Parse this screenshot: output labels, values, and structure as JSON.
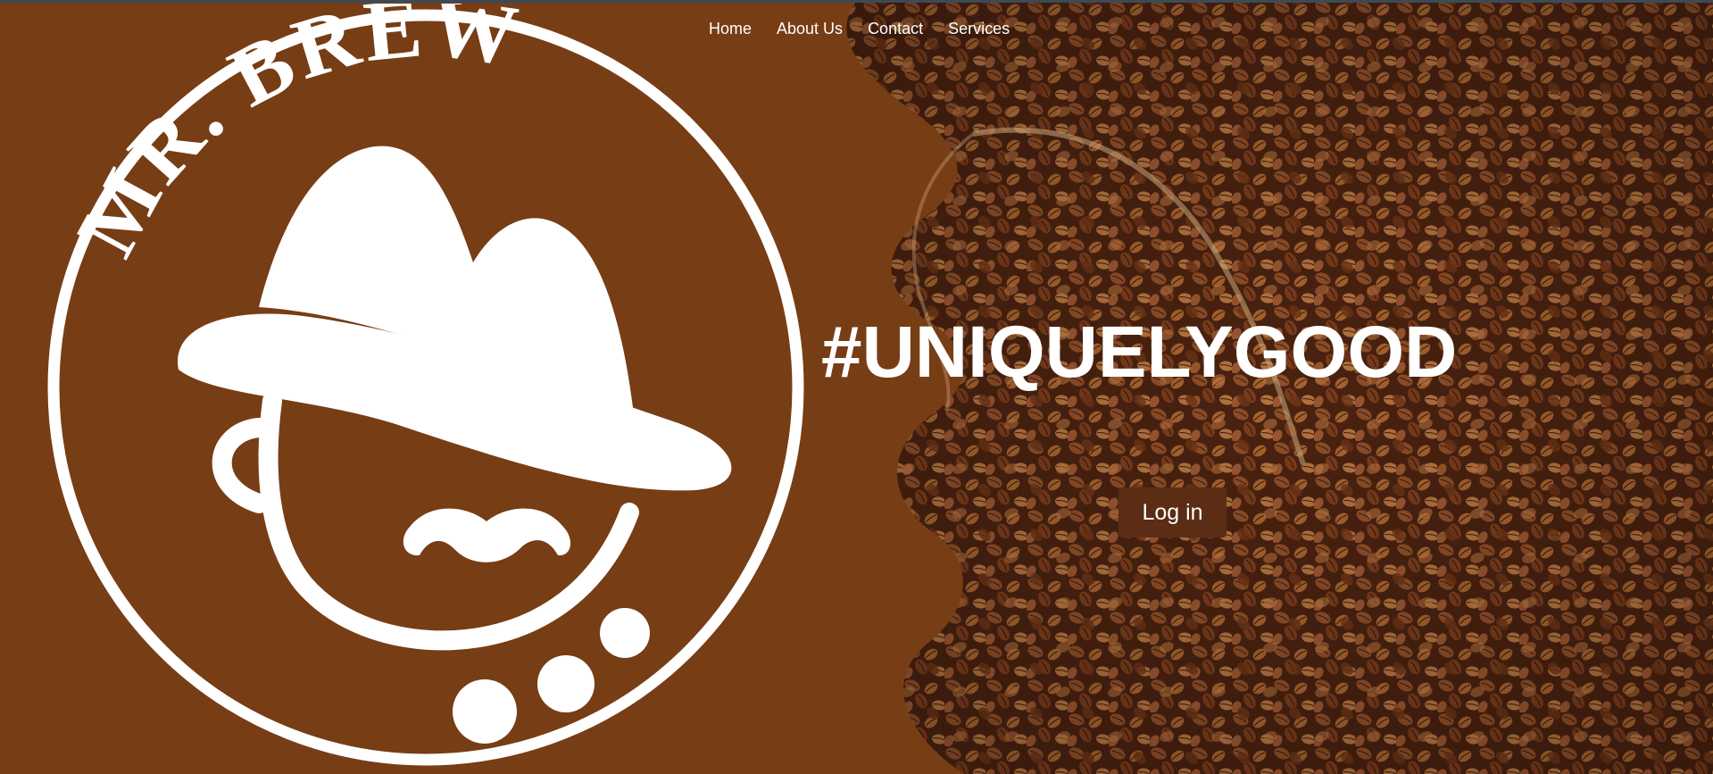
{
  "nav": {
    "items": [
      {
        "label": "Home"
      },
      {
        "label": "About Us"
      },
      {
        "label": "Contact"
      },
      {
        "label": "Services"
      }
    ]
  },
  "hero": {
    "hashtag": "#UNIQUELYGOOD",
    "login_label": "Log in"
  },
  "logo": {
    "brand_text": "MR. BREW"
  },
  "colors": {
    "brand_brown": "#773d15",
    "button_brown": "#5a2d14",
    "text_white": "#ffffff",
    "bean_dark": "#3a1a0c",
    "bean_mid": "#8a4a26",
    "bean_light": "#b06a3a"
  },
  "icons": {
    "logo": "mustache-hat-cup-logo-icon"
  }
}
